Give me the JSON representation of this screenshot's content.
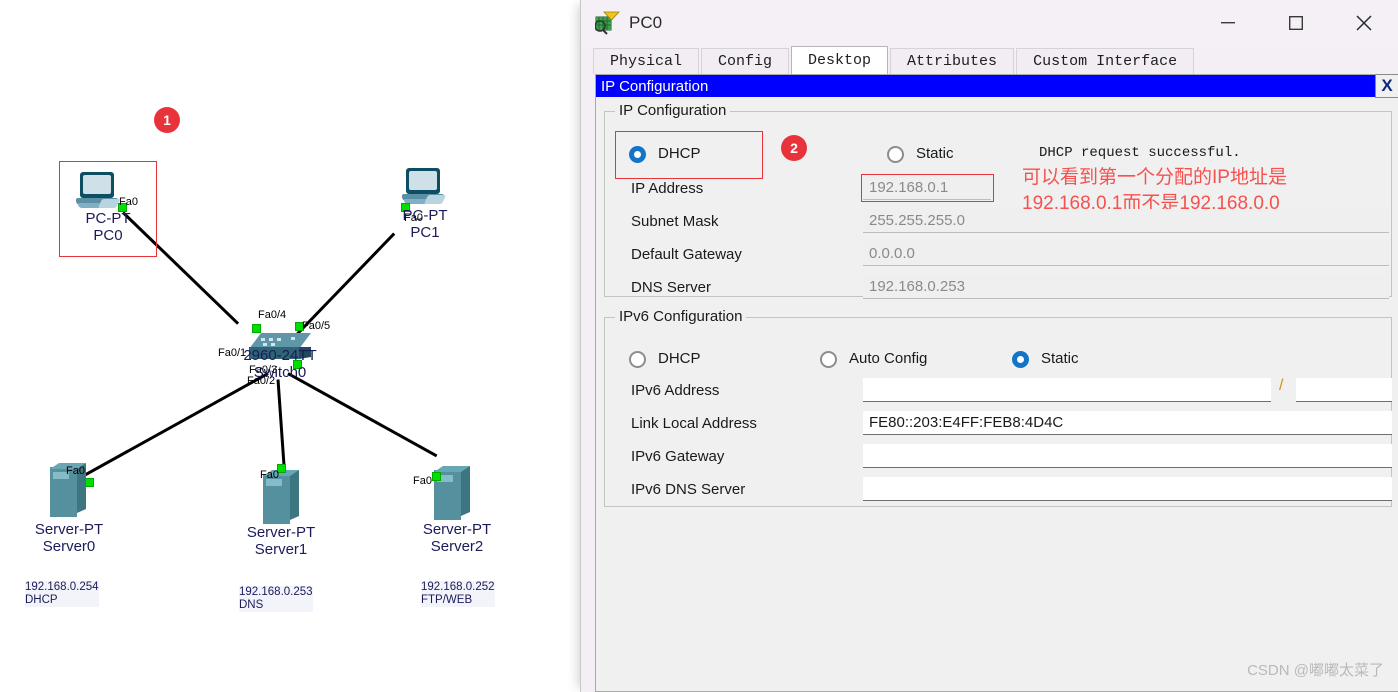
{
  "window": {
    "title": "PC0",
    "icon": "packet-tracer-pc-icon",
    "minimize": "—",
    "maximize": "☐",
    "close": "✕"
  },
  "tabs": [
    {
      "label": "Physical",
      "active": false
    },
    {
      "label": "Config",
      "active": false
    },
    {
      "label": "Desktop",
      "active": true
    },
    {
      "label": "Attributes",
      "active": false
    },
    {
      "label": "Custom Interface",
      "active": false
    }
  ],
  "ip_config_window": {
    "title": "IP Configuration",
    "close_label": "X"
  },
  "ipv4": {
    "legend": "IP Configuration",
    "dhcp_label": "DHCP",
    "static_label": "Static",
    "selected": "DHCP",
    "fields": [
      {
        "label": "IP Address",
        "value": "192.168.0.1",
        "disabled": true,
        "highlight": true
      },
      {
        "label": "Subnet Mask",
        "value": "255.255.255.0",
        "disabled": true,
        "highlight": false
      },
      {
        "label": "Default Gateway",
        "value": "0.0.0.0",
        "disabled": true,
        "highlight": false
      },
      {
        "label": "DNS Server",
        "value": "192.168.0.253",
        "disabled": true,
        "highlight": false
      }
    ],
    "status_message": "DHCP request successful."
  },
  "ipv6": {
    "legend": "IPv6 Configuration",
    "dhcp_label": "DHCP",
    "auto_config_label": "Auto Config",
    "static_label": "Static",
    "selected": "Static",
    "prefix_separator": "/",
    "fields": [
      {
        "label": "IPv6 Address",
        "value": "",
        "editable": true
      },
      {
        "label": "Link Local Address",
        "value": "FE80::203:E4FF:FEB8:4D4C",
        "editable": true
      },
      {
        "label": "IPv6 Gateway",
        "value": "",
        "editable": true
      },
      {
        "label": "IPv6 DNS Server",
        "value": "",
        "editable": true
      }
    ]
  },
  "annotations": {
    "badge_1": "1",
    "badge_2": "2",
    "note_line1": "可以看到第一个分配的IP地址是",
    "note_line2": "192.168.0.1而不是192.168.0.0",
    "color": "#f5514f"
  },
  "topology": {
    "devices": [
      {
        "id": "pc0",
        "type": "PC-PT",
        "model": "PC-PT",
        "name": "PC0",
        "port": "Fa0",
        "ip": "",
        "role": ""
      },
      {
        "id": "pc1",
        "type": "PC-PT",
        "model": "PC-PT",
        "name": "PC1",
        "port": "Fa0",
        "ip": "",
        "role": ""
      },
      {
        "id": "switch0",
        "type": "2960-24TT",
        "model": "2960-24TT",
        "name": "Switch0",
        "port": "",
        "ip": "",
        "role": ""
      },
      {
        "id": "server0",
        "type": "Server-PT",
        "model": "Server-PT",
        "name": "Server0",
        "port": "Fa0",
        "ip": "192.168.0.254",
        "role": "DHCP"
      },
      {
        "id": "server1",
        "type": "Server-PT",
        "model": "Server-PT",
        "name": "Server1",
        "port": "Fa0",
        "ip": "192.168.0.253",
        "role": "DNS"
      },
      {
        "id": "server2",
        "type": "Server-PT",
        "model": "Server-PT",
        "name": "Server2",
        "port": "Fa0",
        "ip": "192.168.0.252",
        "role": "FTP/WEB"
      }
    ],
    "switch_ports": [
      "Fa0/1",
      "Fa0/2",
      "Fa0/3",
      "Fa0/4",
      "Fa0/5"
    ]
  },
  "watermark": "CSDN @嘟嘟太菜了"
}
